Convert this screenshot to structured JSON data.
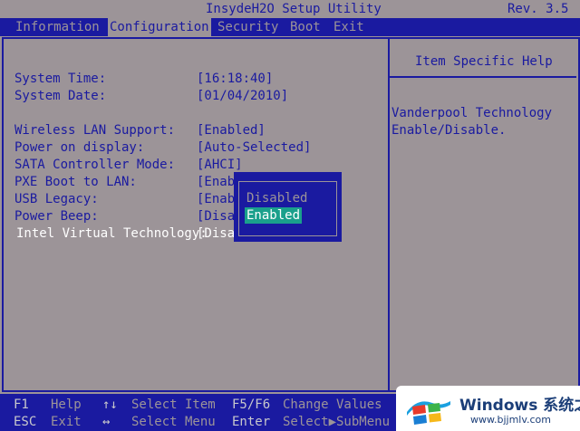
{
  "title": "InsydeH2O Setup Utility",
  "revision": "Rev. 3.5",
  "menu": [
    {
      "label": "Information"
    },
    {
      "label": "Configuration"
    },
    {
      "label": "Security"
    },
    {
      "label": "Boot"
    },
    {
      "label": "Exit"
    }
  ],
  "settings": [
    {
      "label": "System Time:",
      "value": "[16:18:40]"
    },
    {
      "label": "System Date:",
      "value": "[01/04/2010]"
    },
    {
      "label": "Wireless LAN Support:",
      "value": "[Enabled]"
    },
    {
      "label": "Power on display:",
      "value": "[Auto-Selected]"
    },
    {
      "label": "SATA Controller Mode:",
      "value": "[AHCI]"
    },
    {
      "label": "PXE Boot to LAN:",
      "value": "[Enab"
    },
    {
      "label": "USB Legacy:",
      "value": "[Enab"
    },
    {
      "label": "Power Beep:",
      "value": "[Disa"
    },
    {
      "label": "Intel Virtual Technology:",
      "value": "[Disa"
    }
  ],
  "help": {
    "header": "Item Specific Help",
    "lines": [
      "Vanderpool Technology",
      "Enable/Disable."
    ]
  },
  "popup": {
    "options": [
      "Disabled",
      "Enabled"
    ],
    "selected": "Enabled"
  },
  "footer": {
    "row1": [
      {
        "key": "F1",
        "desc": "Help"
      },
      {
        "key": "↑↓",
        "desc": "Select Item"
      },
      {
        "key": "F5/F6",
        "desc": "Change Values"
      }
    ],
    "row2": [
      {
        "key": "ESC",
        "desc": "Exit"
      },
      {
        "key": "↔",
        "desc": "Select Menu"
      },
      {
        "key": "Enter",
        "desc": "Select▶SubMenu"
      }
    ]
  },
  "watermark": {
    "title": "Windows 系统之家",
    "url": "www.bjjmlv.com",
    "logo": "windows-logo-icon"
  },
  "colors": {
    "background": "#9c9498",
    "blue": "#1a1aa0",
    "highlight": "#1aa08c"
  }
}
